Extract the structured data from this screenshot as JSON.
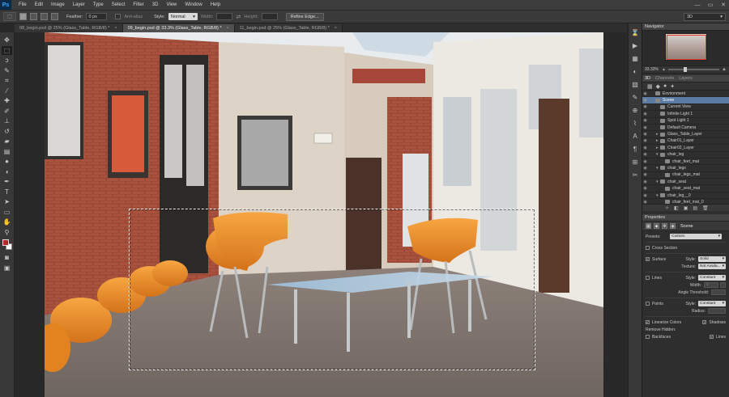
{
  "app": {
    "logo": "Ps"
  },
  "menu": [
    "File",
    "Edit",
    "Image",
    "Layer",
    "Type",
    "Select",
    "Filter",
    "3D",
    "View",
    "Window",
    "Help"
  ],
  "window_controls": {
    "minimize": "—",
    "restore": "▭",
    "close": "✕"
  },
  "options_bar": {
    "feather_label": "Feather:",
    "feather_value": "0 px",
    "antialias_label": "Anti-alias",
    "style_label": "Style:",
    "style_value": "Normal",
    "width_label": "Width:",
    "height_label": "Height:",
    "refine_edge_label": "Refine Edge...",
    "workspace_value": "3D"
  },
  "tabs": [
    {
      "label": "08_begin.psd @ 25% (Glass_Table, RGB/8) *",
      "active": false
    },
    {
      "label": "09_begin.psd @ 33.3% (Glass_Table, RGB/8) *",
      "active": true
    },
    {
      "label": "11_begin.psd @ 25% (Glass_Table, RGB/8) *",
      "active": false
    }
  ],
  "navigator": {
    "title": "Navigator",
    "zoom": "33.33%"
  },
  "panel3d": {
    "tabs": [
      "3D",
      "Channels",
      "Layers"
    ],
    "rows": [
      {
        "label": "Environment",
        "indent": 0,
        "twirl": "",
        "selected": false
      },
      {
        "label": "Scene",
        "indent": 0,
        "twirl": "",
        "selected": true
      },
      {
        "label": "Current View",
        "indent": 1,
        "twirl": "",
        "selected": false
      },
      {
        "label": "Infinite Light 1",
        "indent": 1,
        "twirl": "",
        "selected": false
      },
      {
        "label": "Spot Light 1",
        "indent": 1,
        "twirl": "",
        "selected": false
      },
      {
        "label": "Default Camera",
        "indent": 1,
        "twirl": "",
        "selected": false
      },
      {
        "label": "Glass_Table_Layer",
        "indent": 1,
        "twirl": "▸",
        "selected": false
      },
      {
        "label": "Chair01_Layer",
        "indent": 1,
        "twirl": "▸",
        "selected": false
      },
      {
        "label": "Chair02_Layer",
        "indent": 1,
        "twirl": "▸",
        "selected": false
      },
      {
        "label": "chair_leg",
        "indent": 1,
        "twirl": "▾",
        "selected": false
      },
      {
        "label": "chair_feet_mat",
        "indent": 2,
        "twirl": "",
        "selected": false
      },
      {
        "label": "chair_legs",
        "indent": 1,
        "twirl": "▾",
        "selected": false
      },
      {
        "label": "chair_legs_mat",
        "indent": 2,
        "twirl": "",
        "selected": false
      },
      {
        "label": "chair_seat",
        "indent": 1,
        "twirl": "▾",
        "selected": false
      },
      {
        "label": "chair_seat_mat",
        "indent": 2,
        "twirl": "",
        "selected": false
      },
      {
        "label": "chair_leg__0",
        "indent": 1,
        "twirl": "▾",
        "selected": false
      },
      {
        "label": "chair_feet_mat_0",
        "indent": 2,
        "twirl": "",
        "selected": false
      }
    ]
  },
  "properties": {
    "title": "Properties",
    "scene_label": "Scene",
    "presets_label": "Presets:",
    "presets_value": "Custom",
    "cross_section_label": "Cross Section",
    "surface_label": "Surface",
    "surface_style_label": "Style:",
    "surface_style_value": "Solid",
    "texture_label": "Texture:",
    "texture_value": "Not Availa...",
    "lines_label": "Lines",
    "lines_style_label": "Style:",
    "lines_style_value": "Constant",
    "width_label": "Width:",
    "width_value": "1",
    "angle_label": "Angle Threshold:",
    "points_label": "Points",
    "points_style_label": "Style:",
    "points_style_value": "Constant",
    "radius_label": "Radius:",
    "linearize_label": "Linearize Colors",
    "shadows_label": "Shadows",
    "remove_hidden_label": "Remove Hidden:",
    "backfaces_label": "Backfaces",
    "lines2_label": "Lines"
  },
  "colors": {
    "foreground": "#b3282a",
    "background": "#ffffff",
    "selection": "#5a7ba3"
  }
}
